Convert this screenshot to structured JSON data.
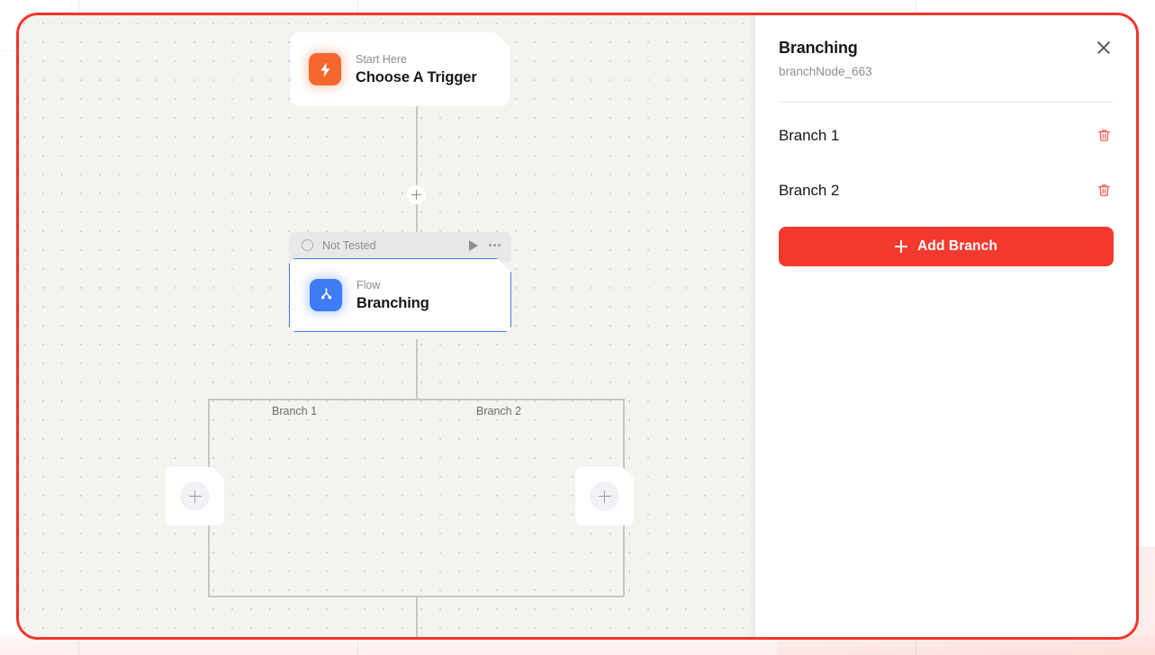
{
  "canvas": {
    "connector_add_icon": "plus-icon",
    "nodes": [
      {
        "id": "trigger",
        "icon": "lightning-bolt-icon",
        "icon_color": "#f4682e",
        "eyebrow": "Start Here",
        "title": "Choose A Trigger"
      },
      {
        "id": "branching",
        "icon": "branching-arrows-icon",
        "icon_color": "#3d7bf7",
        "eyebrow": "Flow",
        "title": "Branching",
        "status_label": "Not Tested",
        "status_icon": "empty-circle-icon",
        "run_icon": "play-triangle-icon",
        "more_icon": "ellipsis-icon",
        "selected_border_color": "#3d7bf7"
      }
    ],
    "branch_labels": [
      "Branch 1",
      "Branch 2"
    ],
    "branch_add_icon": "plus-icon"
  },
  "panel": {
    "title": "Branching",
    "subtitle": "branchNode_663",
    "close_icon": "close-icon",
    "branches": [
      {
        "label": "Branch 1",
        "delete_icon": "trash-icon"
      },
      {
        "label": "Branch 2",
        "delete_icon": "trash-icon"
      }
    ],
    "add_branch_label": "Add Branch",
    "add_branch_icon": "plus-icon",
    "accent_color": "#f4392f"
  },
  "highlight": {
    "border_color": "#f3352b"
  }
}
